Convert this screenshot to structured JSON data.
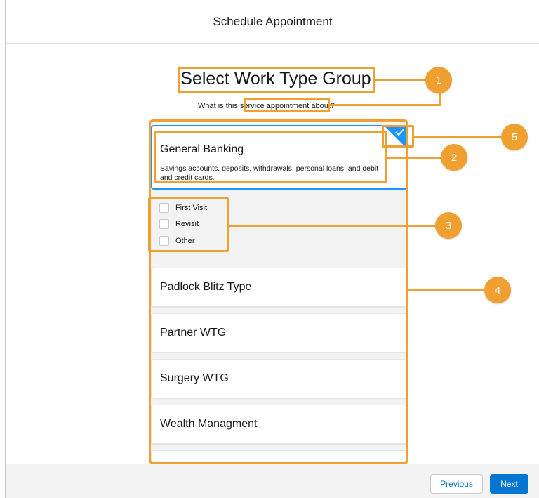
{
  "header": {
    "title": "Schedule Appointment"
  },
  "page": {
    "title": "Select Work Type Group",
    "subtitle": "What is this service appointment about?"
  },
  "selected_group": {
    "title": "General Banking",
    "description": "Savings accounts, deposits, withdrawals, personal loans, and debit and credit cards."
  },
  "options": [
    {
      "label": "First Visit",
      "checked": false
    },
    {
      "label": "Revisit",
      "checked": false
    },
    {
      "label": "Other",
      "checked": false
    }
  ],
  "work_type_groups": [
    {
      "label": "Padlock Blitz Type"
    },
    {
      "label": "Partner WTG"
    },
    {
      "label": "Surgery WTG"
    },
    {
      "label": "Wealth Managment"
    }
  ],
  "footer": {
    "previous_label": "Previous",
    "next_label": "Next"
  },
  "annotations": [
    {
      "number": "1"
    },
    {
      "number": "2"
    },
    {
      "number": "3"
    },
    {
      "number": "4"
    },
    {
      "number": "5"
    }
  ],
  "colors": {
    "accent": "#0176d3",
    "selected_border": "#1b96ff",
    "annotation": "#f0a030"
  }
}
